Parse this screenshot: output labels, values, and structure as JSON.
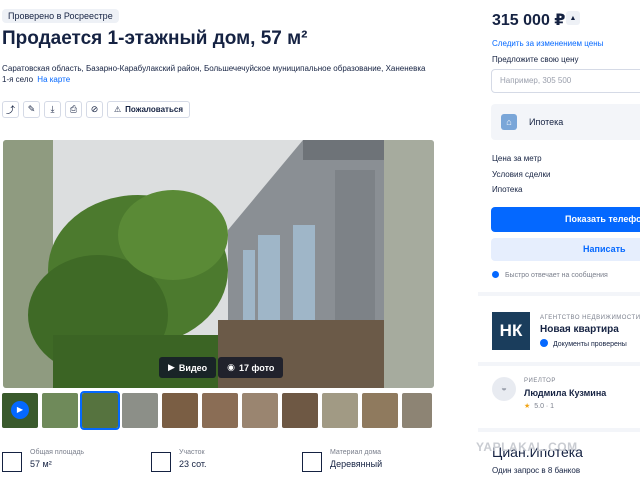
{
  "badge": "Проверено в Росреестре",
  "title": "Продается 1-этажный дом, 57 м²",
  "address": "Саратовская область, Базарно-Карабулакский район, Большечечуйское муниципальное образование, Ханеневка 1-я село",
  "map_link": "На карте",
  "toolbar": {
    "icons": [
      "share-icon",
      "edit-icon",
      "download-icon",
      "print-icon",
      "hide-icon"
    ],
    "complain_label": "Пожаловаться"
  },
  "gallery": {
    "video_label": "Видео",
    "photos_label": "17 фото",
    "thumbnail_count": 11
  },
  "stats": [
    {
      "label": "Общая площадь",
      "value": "57 м²"
    },
    {
      "label": "Участок",
      "value": "23 сот."
    },
    {
      "label": "Материал дома",
      "value": "Деревянный"
    }
  ],
  "sidebar": {
    "price": "315 000 ₽",
    "follow": "Следить за изменением цены",
    "suggest": "Предложите свою цену",
    "suggest_placeholder": "Например, 305 500",
    "ipoteka": "Ипотека",
    "conditions": [
      "Цена за метр",
      "Условия сделки",
      "Ипотека"
    ],
    "show_phone": "Показать телефон",
    "write": "Написать",
    "fast_reply": "Быстро отвечает на сообщения"
  },
  "agency": {
    "logo": "НК",
    "kind": "АГЕНТСТВО НЕДВИЖИМОСТИ",
    "name": "Новая квартира",
    "verified": "Документы проверены"
  },
  "realtor": {
    "kind": "РИЕЛТОР",
    "name": "Людмила Кузмина",
    "rating": "5.0 · 1"
  },
  "cian": {
    "title": "Циан.Ипотека",
    "sub": "Один запрос в 8 банков"
  },
  "watermark": "YAPLAKAL.COM",
  "colors": {
    "accent": "#0468ff",
    "text": "#152242"
  }
}
